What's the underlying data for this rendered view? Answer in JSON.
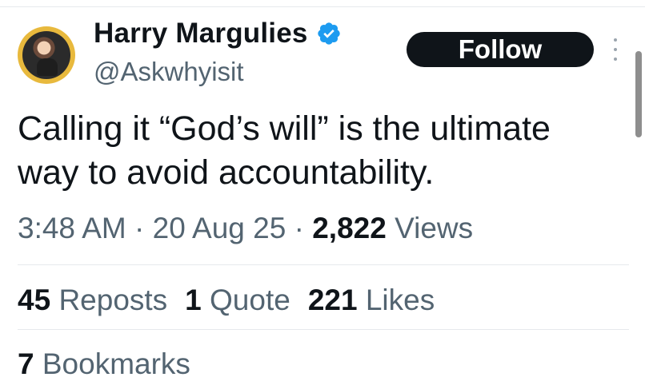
{
  "author": {
    "name": "Harry Margulies",
    "handle": "@Askwhyisit",
    "verified": true,
    "verified_color": "#1d9bf0"
  },
  "follow_label": "Follow",
  "tweet": {
    "text": "Calling it “God’s will” is the ultimate way to avoid accountability.",
    "time": "3:48 AM",
    "date": "20 Aug 25",
    "separator": "·",
    "views_count": "2,822",
    "views_label": "Views"
  },
  "stats": {
    "reposts_count": "45",
    "reposts_label": "Reposts",
    "quotes_count": "1",
    "quotes_label": "Quote",
    "likes_count": "221",
    "likes_label": "Likes",
    "bookmarks_count": "7",
    "bookmarks_label": "Bookmarks"
  },
  "icons": {
    "verified": "verified-badge-icon",
    "more": "more-options-icon"
  }
}
